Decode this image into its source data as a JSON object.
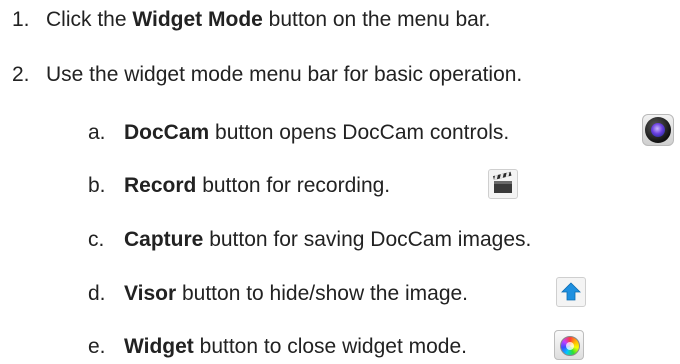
{
  "steps": [
    {
      "number": "1.",
      "before": "Click the ",
      "bold": "Widget Mode",
      "after": " button on the menu bar."
    },
    {
      "number": "2.",
      "before": "Use the widget mode menu bar for basic operation.",
      "bold": "",
      "after": ""
    }
  ],
  "substeps": [
    {
      "letter": "a.",
      "bold": "DocCam",
      "text": " button opens DocCam controls.",
      "icon": "doccam-lens-icon"
    },
    {
      "letter": "b.",
      "bold": "Record",
      "text": " button for recording.",
      "icon": "clapperboard-icon"
    },
    {
      "letter": "c.",
      "bold": "Capture",
      "text": " button for saving DocCam images.",
      "icon": ""
    },
    {
      "letter": "d.",
      "bold": "Visor",
      "text": " button to hide/show the image.",
      "icon": "up-arrow-icon"
    },
    {
      "letter": "e.",
      "bold": "Widget",
      "text": " button to close widget mode.",
      "icon": "color-wheel-icon"
    }
  ],
  "colors": {
    "text": "#222222",
    "visor_arrow": "#1e90e0",
    "doccam_lens": "#6b3fe0"
  }
}
